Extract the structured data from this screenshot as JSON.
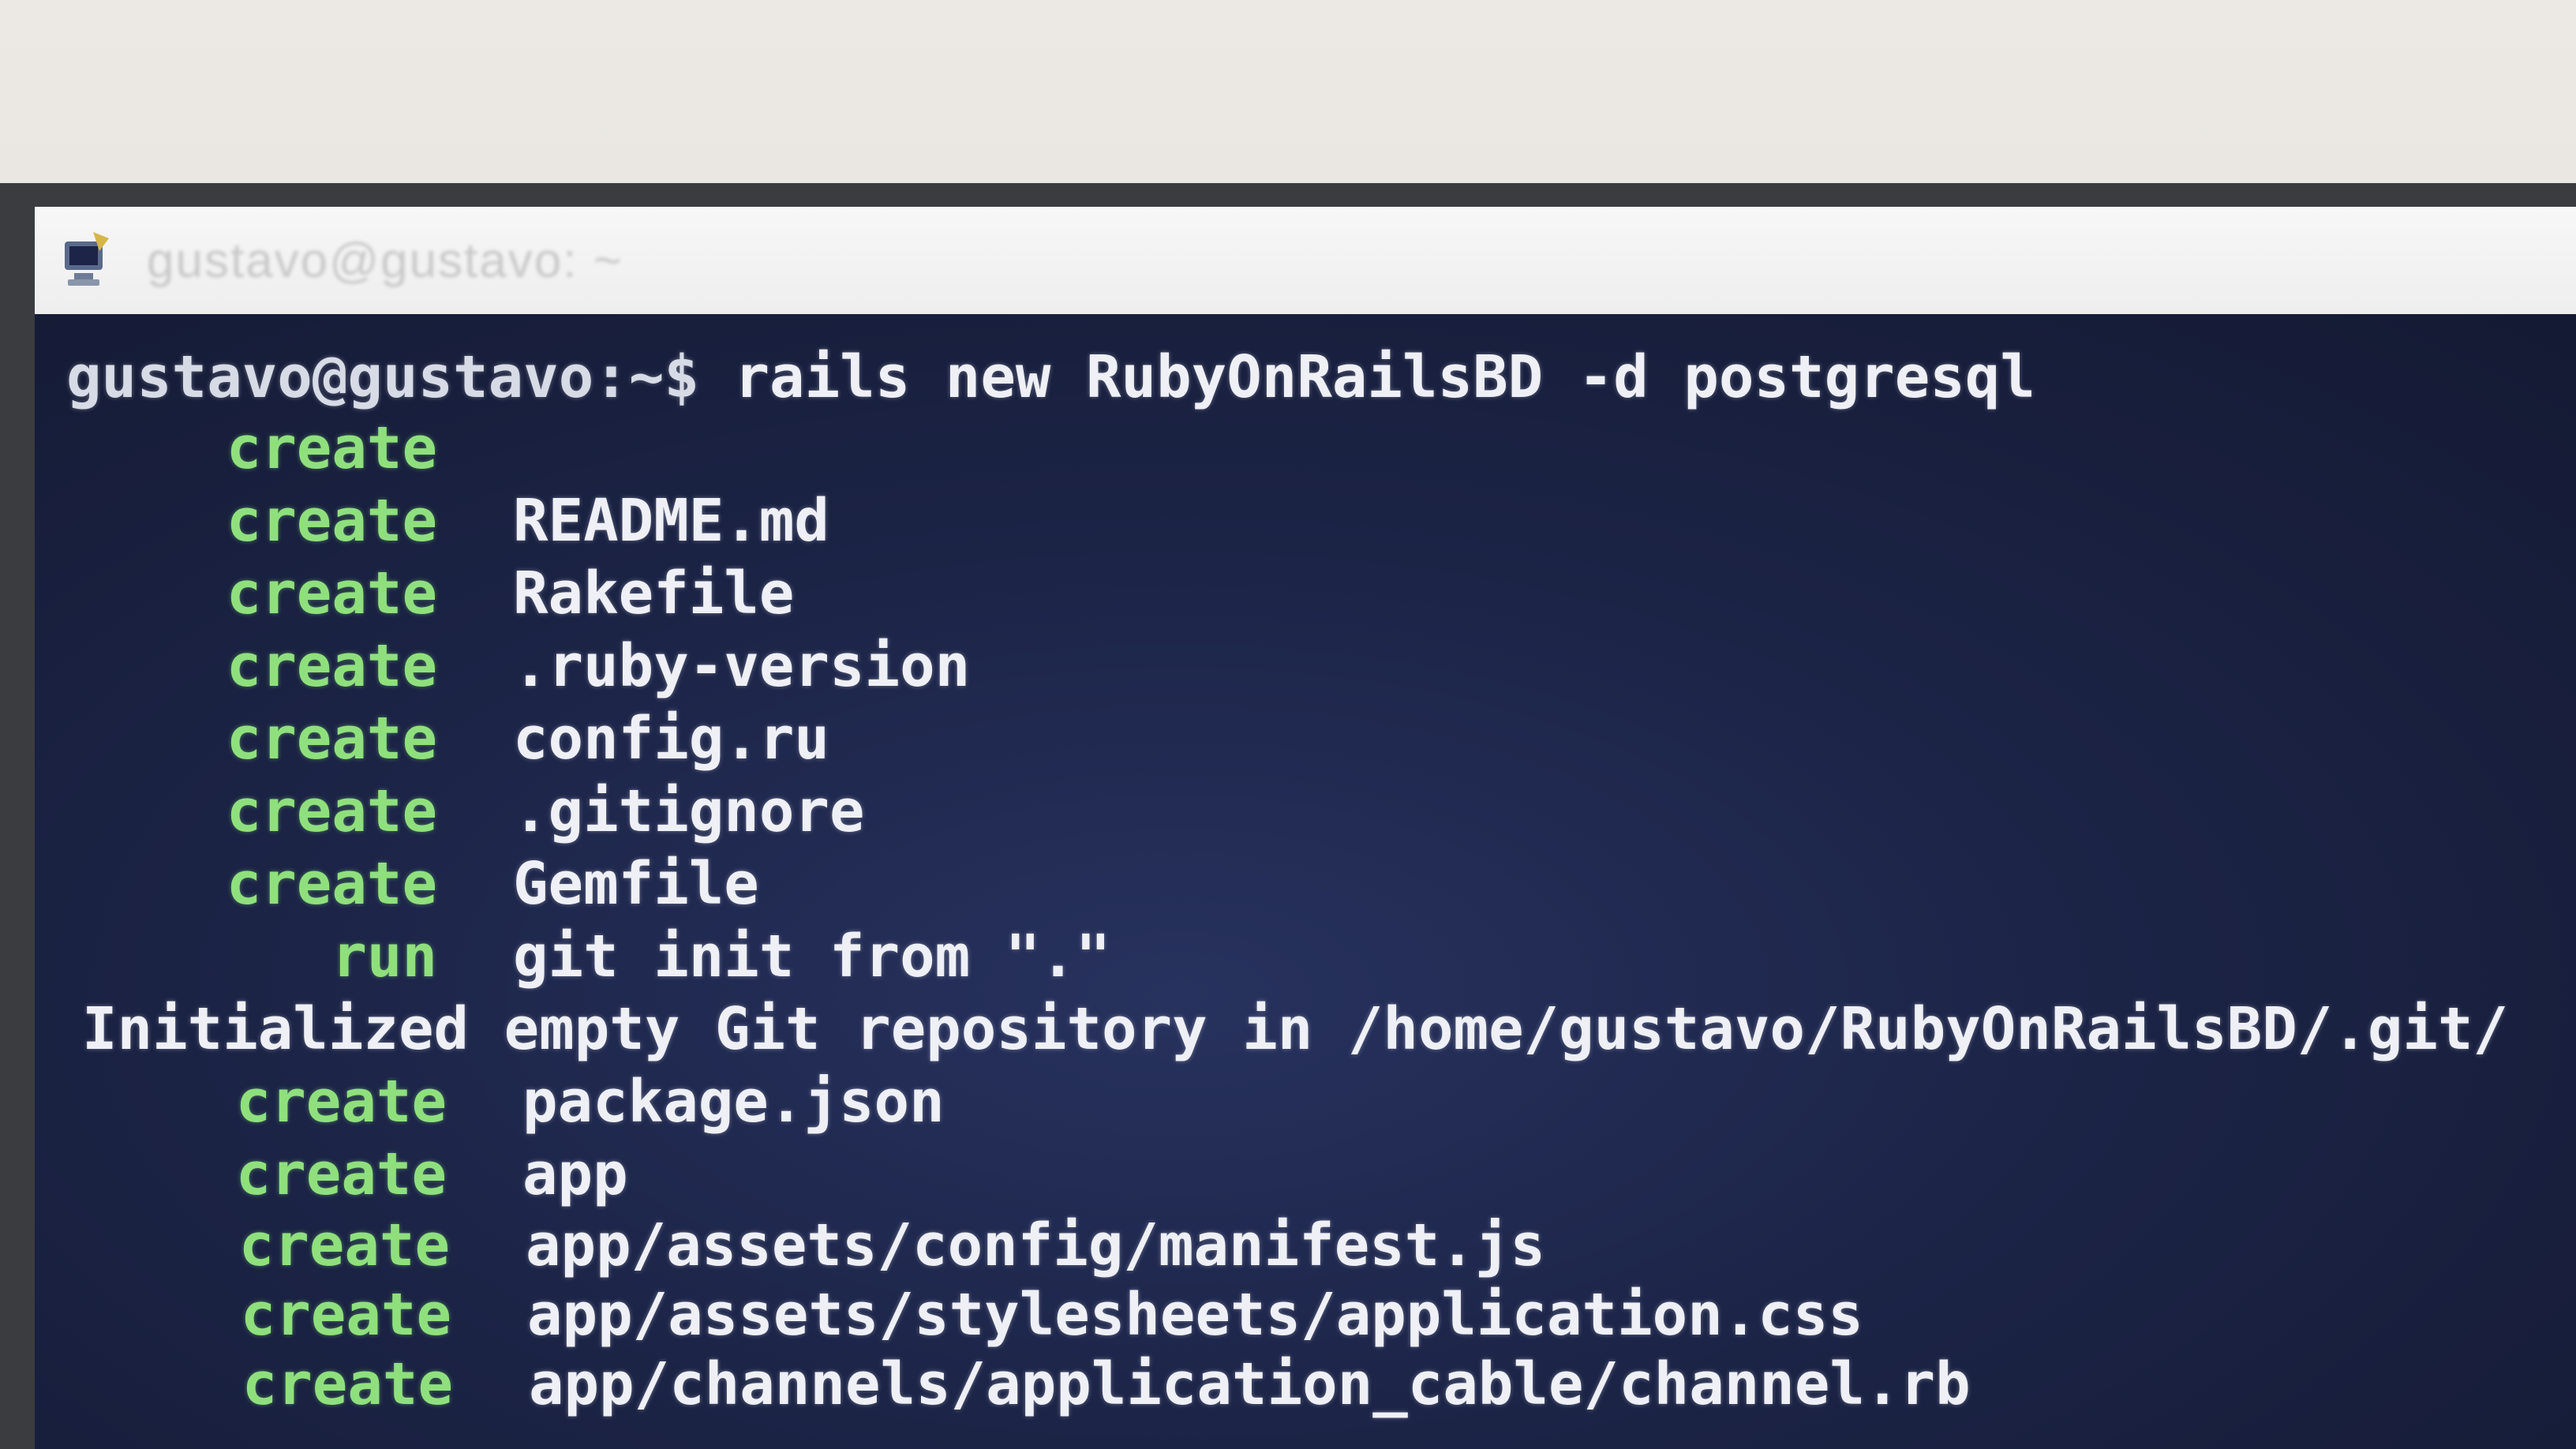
{
  "window": {
    "title": "gustavo@gustavo: ~"
  },
  "terminal": {
    "prompt": "gustavo@gustavo:~$ ",
    "command": "rails new RubyOnRailsBD -d postgresql",
    "lines": [
      {
        "verb": "create",
        "arg": ""
      },
      {
        "verb": "create",
        "arg": "README.md"
      },
      {
        "verb": "create",
        "arg": "Rakefile"
      },
      {
        "verb": "create",
        "arg": ".ruby-version"
      },
      {
        "verb": "create",
        "arg": "config.ru"
      },
      {
        "verb": "create",
        "arg": ".gitignore"
      },
      {
        "verb": "create",
        "arg": "Gemfile"
      },
      {
        "verb": "run",
        "arg": "git init from \".\""
      }
    ],
    "git_message": "Initialized empty Git repository in /home/gustavo/RubyOnRailsBD/.git/",
    "lines_after": [
      {
        "verb": "create",
        "arg": "package.json"
      },
      {
        "verb": "create",
        "arg": "app"
      },
      {
        "verb": "create",
        "arg": "app/assets/config/manifest.js"
      },
      {
        "verb": "create",
        "arg": "app/assets/stylesheets/application.css"
      },
      {
        "verb": "create",
        "arg": "app/channels/application_cable/channel.rb"
      }
    ]
  },
  "colors": {
    "verb": "#8fe07d",
    "text": "#eef0f6",
    "background": "#1c2447"
  },
  "icons": {
    "app": "terminal-app-icon"
  }
}
